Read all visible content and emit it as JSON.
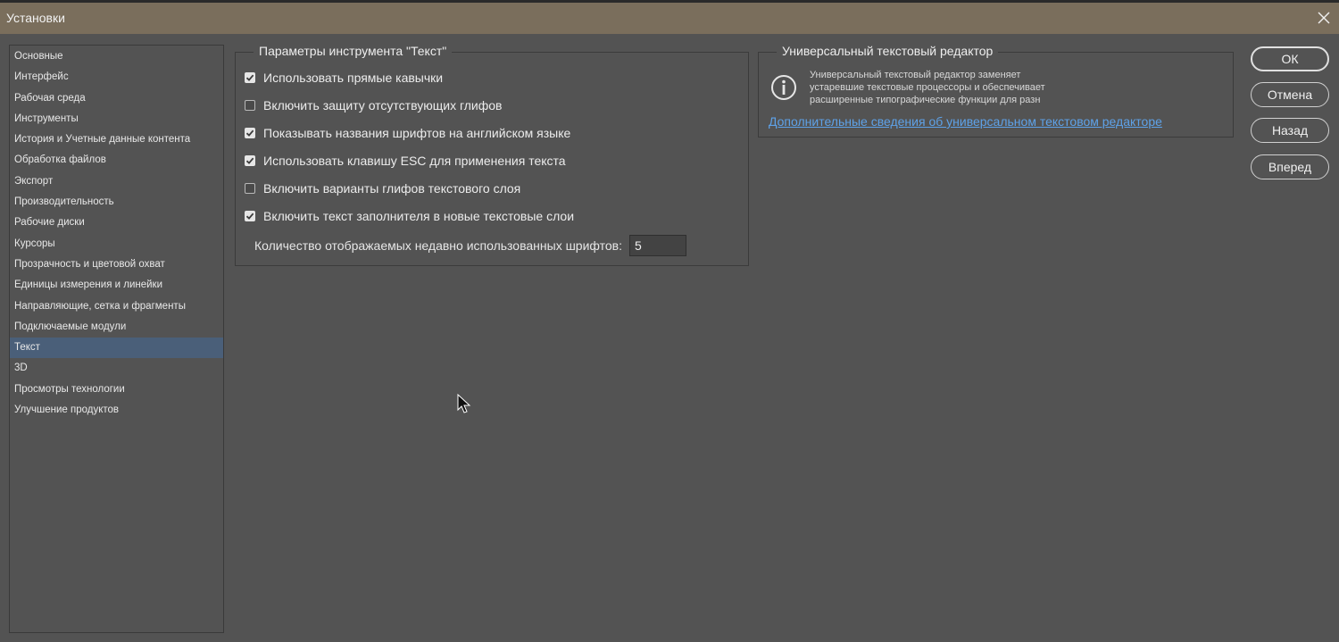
{
  "window": {
    "title": "Установки"
  },
  "sidebar": {
    "items": [
      {
        "label": "Основные"
      },
      {
        "label": "Интерфейс"
      },
      {
        "label": "Рабочая среда"
      },
      {
        "label": "Инструменты"
      },
      {
        "label": "История и Учетные данные контента"
      },
      {
        "label": "Обработка файлов"
      },
      {
        "label": "Экспорт"
      },
      {
        "label": "Производительность"
      },
      {
        "label": "Рабочие диски"
      },
      {
        "label": "Курсоры"
      },
      {
        "label": "Прозрачность и цветовой охват"
      },
      {
        "label": "Единицы измерения и линейки"
      },
      {
        "label": "Направляющие, сетка и фрагменты"
      },
      {
        "label": "Подключаемые модули"
      },
      {
        "label": "Текст",
        "selected": true
      },
      {
        "label": "3D"
      },
      {
        "label": "Просмотры технологии"
      },
      {
        "label": "Улучшение продуктов"
      }
    ]
  },
  "text_options": {
    "title": "Параметры инструмента \"Текст\"",
    "options": [
      {
        "label": "Использовать прямые кавычки",
        "checked": true
      },
      {
        "label": "Включить защиту отсутствующих глифов",
        "checked": false
      },
      {
        "label": "Показывать названия шрифтов на английском языке",
        "checked": true
      },
      {
        "label": "Использовать клавишу ESC для применения текста",
        "checked": true
      },
      {
        "label": "Включить варианты глифов текстового слоя",
        "checked": false
      },
      {
        "label": "Включить текст заполнителя в новые текстовые слои",
        "checked": true
      }
    ],
    "recent_fonts_label": "Количество отображаемых недавно использованных шрифтов:",
    "recent_fonts_value": "5"
  },
  "universal_editor": {
    "title": "Универсальный текстовый редактор",
    "description_lines": [
      "Универсальный текстовый редактор заменяет",
      "устаревшие текстовые процессоры и обеспечивает",
      "расширенные типографические функции для разн"
    ],
    "link": "Дополнительные сведения об универсальном текстовом редакторе",
    "icon": "info-icon"
  },
  "buttons": {
    "ok": "ОК",
    "cancel": "Отмена",
    "back": "Назад",
    "forward": "Вперед"
  },
  "colors": {
    "background": "#535353",
    "titlebar": "#7a6e5c",
    "selected_item": "#4a5f79",
    "link": "#5ea2e8"
  }
}
